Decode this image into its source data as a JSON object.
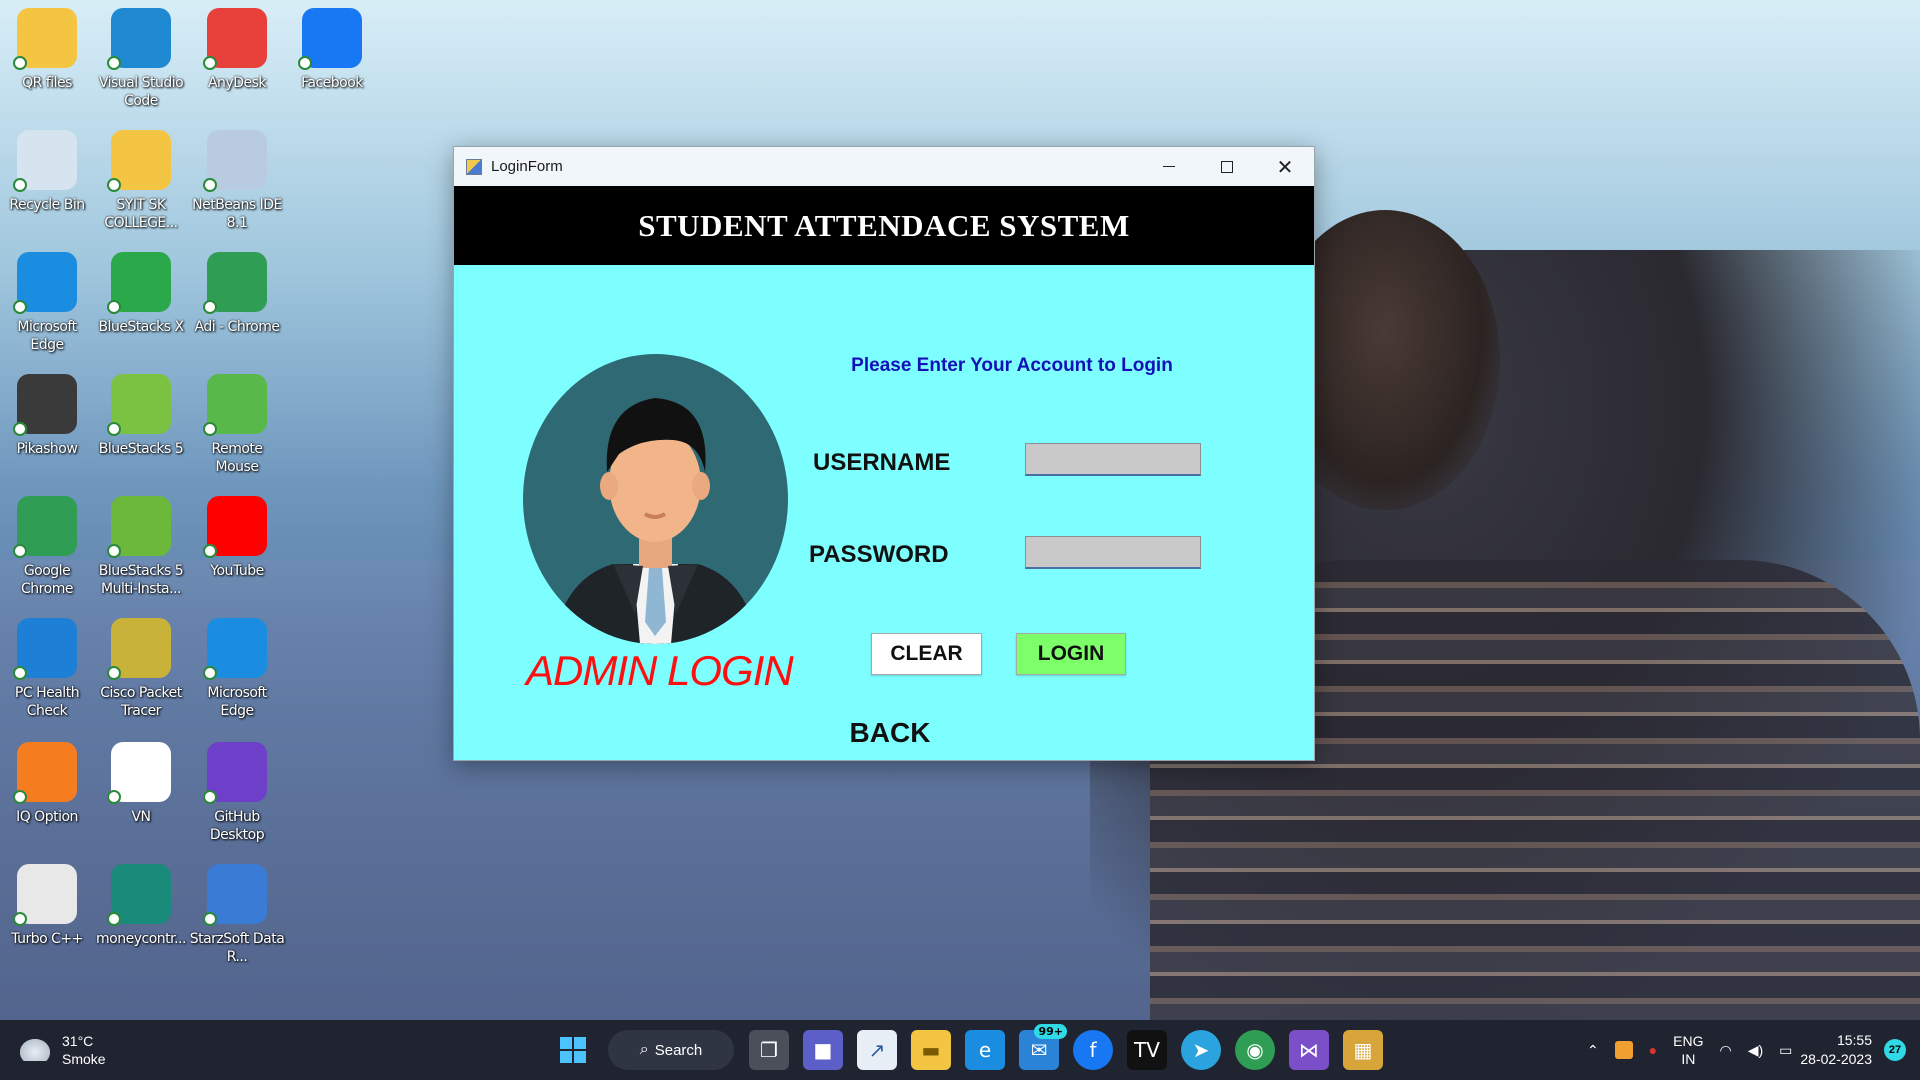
{
  "desktop": {
    "icons": [
      {
        "label": "QR files",
        "icon": "folder-icon",
        "color": "#f4c542"
      },
      {
        "label": "Visual Studio Code",
        "icon": "vscode-icon",
        "color": "#1f8ad2"
      },
      {
        "label": "AnyDesk",
        "icon": "anydesk-icon",
        "color": "#e8403a"
      },
      {
        "label": "Facebook",
        "icon": "facebook-icon",
        "color": "#1877f2"
      },
      {
        "label": "Recycle Bin",
        "icon": "recycle-bin-icon",
        "color": "#d6e4ef"
      },
      {
        "label": "SYIT SK COLLEGE...",
        "icon": "folder-icon",
        "color": "#f4c542"
      },
      {
        "label": "NetBeans IDE 8.1",
        "icon": "netbeans-icon",
        "color": "#b8cbe0"
      },
      {
        "label": "Microsoft Edge",
        "icon": "edge-icon",
        "color": "#1b8de0"
      },
      {
        "label": "BlueStacks X",
        "icon": "bluestacks-x-icon",
        "color": "#2aa84a"
      },
      {
        "label": "Adi - Chrome",
        "icon": "chrome-icon",
        "color": "#2f9d54"
      },
      {
        "label": "Pikashow",
        "icon": "pikashow-icon",
        "color": "#3a3a3a"
      },
      {
        "label": "BlueStacks 5",
        "icon": "bluestacks-icon",
        "color": "#7cc242"
      },
      {
        "label": "Remote Mouse",
        "icon": "remote-mouse-icon",
        "color": "#59b84a"
      },
      {
        "label": "Google Chrome",
        "icon": "chrome-icon",
        "color": "#2f9d54"
      },
      {
        "label": "BlueStacks 5 Multi-Insta...",
        "icon": "bluestacks-multi-icon",
        "color": "#6bb83b"
      },
      {
        "label": "YouTube",
        "icon": "youtube-icon",
        "color": "#ff0000"
      },
      {
        "label": "PC Health Check",
        "icon": "pc-health-icon",
        "color": "#1e7fd6"
      },
      {
        "label": "Cisco Packet Tracer",
        "icon": "packet-tracer-icon",
        "color": "#c8b23a"
      },
      {
        "label": "Microsoft Edge",
        "icon": "edge-icon",
        "color": "#1b8de0"
      },
      {
        "label": "IQ Option",
        "icon": "iq-option-icon",
        "color": "#f57c1f"
      },
      {
        "label": "VN",
        "icon": "vn-icon",
        "color": "#ffffff"
      },
      {
        "label": "GitHub Desktop",
        "icon": "github-icon",
        "color": "#6e40c9"
      },
      {
        "label": "Turbo C++",
        "icon": "turbo-cpp-icon",
        "color": "#e8e8e8"
      },
      {
        "label": "moneycontr...",
        "icon": "moneycontrol-icon",
        "color": "#1a8a7a"
      },
      {
        "label": "StarzSoft Data R...",
        "icon": "starzsoft-icon",
        "color": "#3a7bd5"
      }
    ]
  },
  "window": {
    "title": "LoginForm",
    "header": "STUDENT ATTENDACE SYSTEM",
    "prompt": "Please Enter Your Account to Login",
    "admin_label": "ADMIN LOGIN",
    "username_label": "USERNAME",
    "password_label": "PASSWORD",
    "username_value": "",
    "password_value": "",
    "clear_label": "CLEAR",
    "login_label": "LOGIN",
    "back_label": "BACK",
    "colors": {
      "background": "#7effff",
      "header": "#000000",
      "prompt": "#1212b8",
      "admin": "#ff1010",
      "login_button": "#7dff6a",
      "clear_button": "#ffffff"
    }
  },
  "taskbar": {
    "weather_temp": "31°C",
    "weather_desc": "Smoke",
    "search_label": "Search",
    "mail_badge": "99+",
    "lang_top": "ENG",
    "lang_bottom": "IN",
    "time": "15:55",
    "date": "28-02-2023",
    "notification_count": "27"
  }
}
